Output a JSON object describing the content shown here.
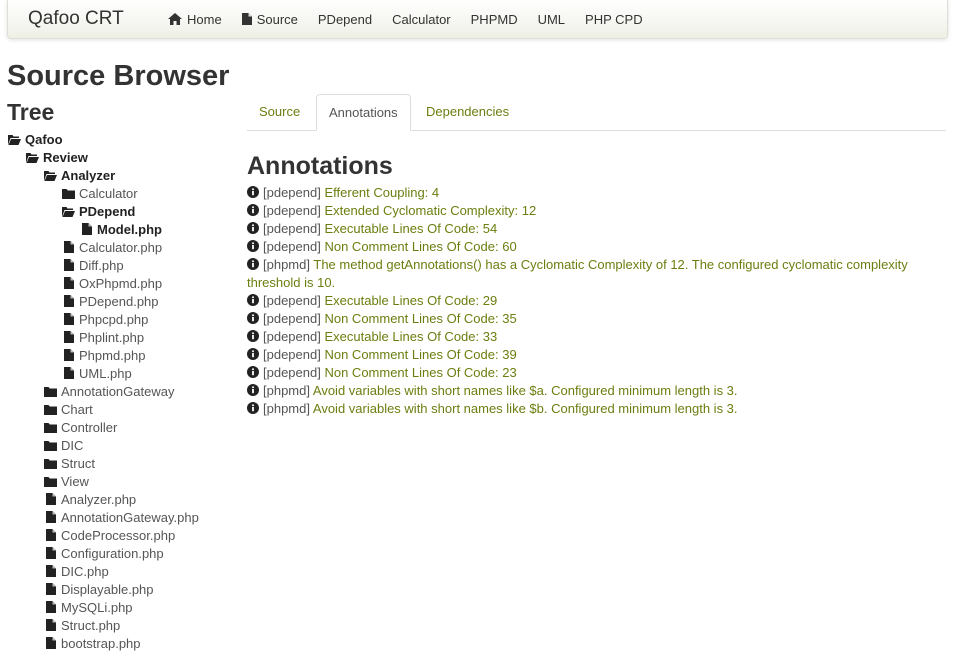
{
  "brand": "Qafoo CRT",
  "nav": [
    {
      "label": "Home",
      "icon": "home-icon"
    },
    {
      "label": "Source",
      "icon": "file-icon"
    },
    {
      "label": "PDepend",
      "icon": ""
    },
    {
      "label": "Calculator",
      "icon": ""
    },
    {
      "label": "PHPMD",
      "icon": ""
    },
    {
      "label": "UML",
      "icon": ""
    },
    {
      "label": "PHP CPD",
      "icon": ""
    }
  ],
  "page_title": "Source Browser",
  "tree_title": "Tree",
  "tree": [
    {
      "label": "Qafoo",
      "type": "folder-open",
      "bold": true
    },
    {
      "label": "Review",
      "type": "folder-open",
      "bold": true
    },
    {
      "label": "Analyzer",
      "type": "folder-open",
      "bold": true
    },
    {
      "label": "Calculator",
      "type": "folder",
      "bold": false
    },
    {
      "label": "PDepend",
      "type": "folder-open",
      "bold": true
    },
    {
      "label": "Model.php",
      "type": "file",
      "bold": true
    },
    {
      "label": "Calculator.php",
      "type": "file",
      "bold": false
    },
    {
      "label": "Diff.php",
      "type": "file",
      "bold": false
    },
    {
      "label": "OxPhpmd.php",
      "type": "file",
      "bold": false
    },
    {
      "label": "PDepend.php",
      "type": "file",
      "bold": false
    },
    {
      "label": "Phpcpd.php",
      "type": "file",
      "bold": false
    },
    {
      "label": "Phplint.php",
      "type": "file",
      "bold": false
    },
    {
      "label": "Phpmd.php",
      "type": "file",
      "bold": false
    },
    {
      "label": "UML.php",
      "type": "file",
      "bold": false
    },
    {
      "label": "AnnotationGateway",
      "type": "folder",
      "bold": false
    },
    {
      "label": "Chart",
      "type": "folder",
      "bold": false
    },
    {
      "label": "Controller",
      "type": "folder",
      "bold": false
    },
    {
      "label": "DIC",
      "type": "folder",
      "bold": false
    },
    {
      "label": "Struct",
      "type": "folder",
      "bold": false
    },
    {
      "label": "View",
      "type": "folder",
      "bold": false
    },
    {
      "label": "Analyzer.php",
      "type": "file",
      "bold": false
    },
    {
      "label": "AnnotationGateway.php",
      "type": "file",
      "bold": false
    },
    {
      "label": "CodeProcessor.php",
      "type": "file",
      "bold": false
    },
    {
      "label": "Configuration.php",
      "type": "file",
      "bold": false
    },
    {
      "label": "DIC.php",
      "type": "file",
      "bold": false
    },
    {
      "label": "Displayable.php",
      "type": "file",
      "bold": false
    },
    {
      "label": "MySQLi.php",
      "type": "file",
      "bold": false
    },
    {
      "label": "Struct.php",
      "type": "file",
      "bold": false
    },
    {
      "label": "bootstrap.php",
      "type": "file",
      "bold": false
    }
  ],
  "tabs": [
    {
      "label": "Source",
      "active": false
    },
    {
      "label": "Annotations",
      "active": true
    },
    {
      "label": "Dependencies",
      "active": false
    }
  ],
  "annotations_title": "Annotations",
  "annotations": [
    {
      "source": "[pdepend]",
      "message": "Efferent Coupling: 4"
    },
    {
      "source": "[pdepend]",
      "message": "Extended Cyclomatic Complexity: 12"
    },
    {
      "source": "[pdepend]",
      "message": "Executable Lines Of Code: 54"
    },
    {
      "source": "[pdepend]",
      "message": "Non Comment Lines Of Code: 60"
    },
    {
      "source": "[phpmd]",
      "message": "The method getAnnotations() has a Cyclomatic Complexity of 12. The configured cyclomatic complexity threshold is 10."
    },
    {
      "source": "[pdepend]",
      "message": "Executable Lines Of Code: 29"
    },
    {
      "source": "[pdepend]",
      "message": "Non Comment Lines Of Code: 35"
    },
    {
      "source": "[pdepend]",
      "message": "Executable Lines Of Code: 33"
    },
    {
      "source": "[pdepend]",
      "message": "Non Comment Lines Of Code: 39"
    },
    {
      "source": "[pdepend]",
      "message": "Non Comment Lines Of Code: 23"
    },
    {
      "source": "[phpmd]",
      "message": "Avoid variables with short names like $a. Configured minimum length is 3."
    },
    {
      "source": "[phpmd]",
      "message": "Avoid variables with short names like $b. Configured minimum length is 3."
    }
  ],
  "colors": {
    "link": "#6a7f10",
    "text": "#333333",
    "muted": "#555555"
  }
}
